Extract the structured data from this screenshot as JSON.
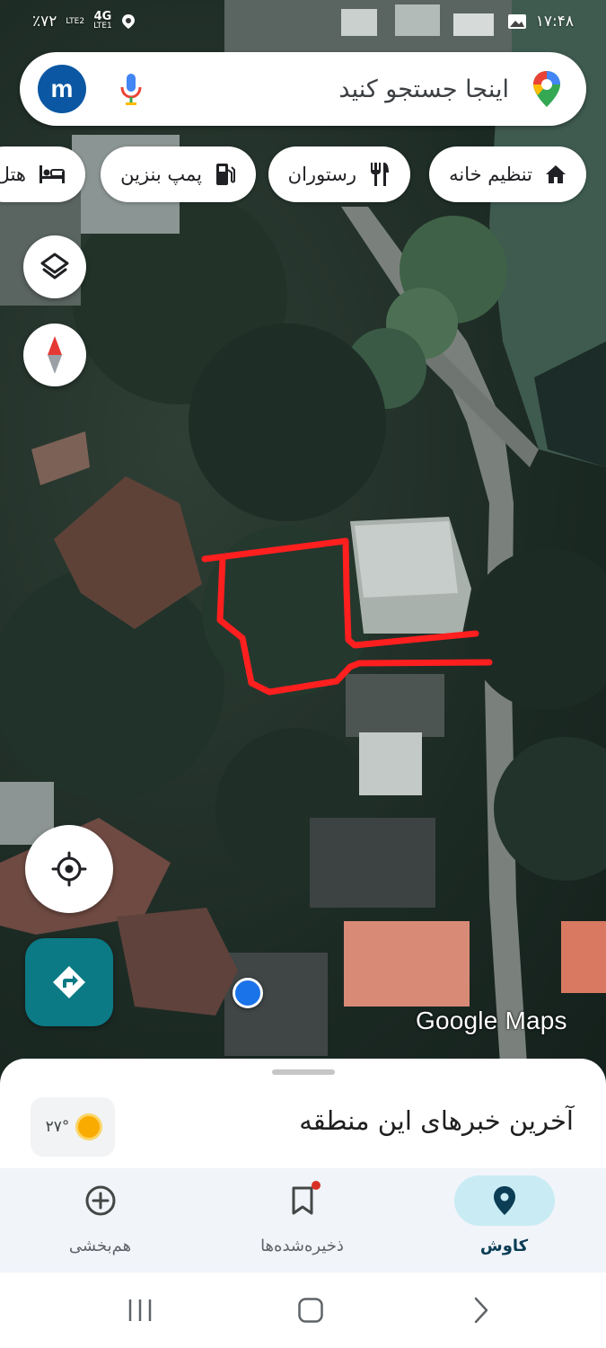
{
  "status_bar": {
    "time": "۱۷:۴۸",
    "battery": "٪۷۲",
    "signal_1_label": "LTE2",
    "signal_2_network": "4G",
    "signal_2_label": "LTE1"
  },
  "search": {
    "placeholder": "اینجا جستجو کنید",
    "avatar_letter": "m",
    "icons": {
      "logo": "google-maps-pin-icon",
      "mic": "microphone-icon"
    }
  },
  "chips": [
    {
      "label": "تنظیم خانه",
      "icon": "home-icon"
    },
    {
      "label": "رستوران",
      "icon": "restaurant-icon"
    },
    {
      "label": "پمپ بنزین",
      "icon": "gas-station-icon"
    },
    {
      "label": "هتل",
      "icon": "hotel-icon"
    }
  ],
  "map": {
    "watermark": "Google Maps",
    "controls": [
      "layers-icon",
      "compass-icon",
      "my-location-icon",
      "directions-icon"
    ]
  },
  "sheet": {
    "title": "آخرین خبرهای این منطقه",
    "weather_temp": "۲۷°"
  },
  "nav": [
    {
      "label": "کاوش",
      "icon": "explore-pin-icon",
      "active": true
    },
    {
      "label": "ذخیره‌شده‌ها",
      "icon": "bookmark-icon",
      "active": false,
      "has_badge": true
    },
    {
      "label": "هم‌بخشی",
      "icon": "add-circle-icon",
      "active": false
    }
  ],
  "colors": {
    "accent": "#0b7a85",
    "avatar": "#0b57a3",
    "nav_active_pill": "#c9ecf4",
    "drawn_outline": "#ff1f1f",
    "location_dot": "#1a73e8"
  }
}
